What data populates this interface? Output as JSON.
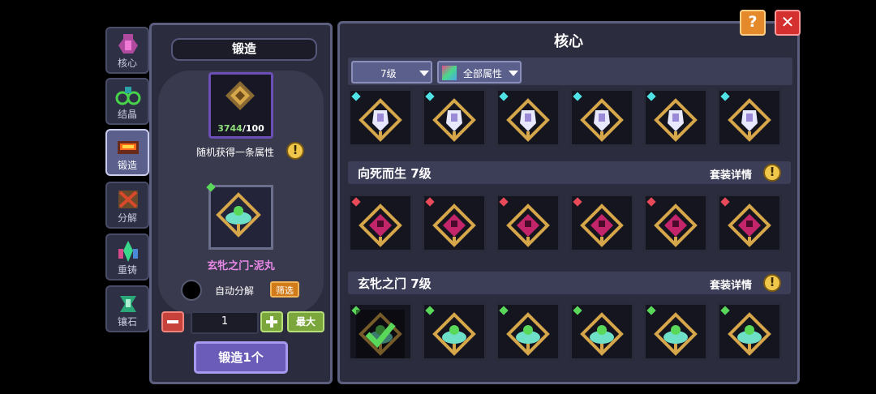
{
  "nav_tabs": [
    {
      "label": "核心",
      "icon": "core-icon"
    },
    {
      "label": "结晶",
      "icon": "crystal-icon"
    },
    {
      "label": "锻造",
      "icon": "forge-icon"
    },
    {
      "label": "分解",
      "icon": "disassemble-icon"
    },
    {
      "label": "重铸",
      "icon": "recast-icon"
    },
    {
      "label": "镶石",
      "icon": "inlay-icon"
    }
  ],
  "forge": {
    "title": "锻造",
    "material_current": "3744",
    "material_required": "/100",
    "random_attr_text": "随机获得一条属性",
    "core_name": "玄牝之门-泥丸",
    "auto_disassemble_label": "自动分解",
    "filter_label": "筛选",
    "quantity": "1",
    "max_label": "最大",
    "forge_button_label": "锻造1个"
  },
  "cores_panel": {
    "title": "核心",
    "level_filter": "7级",
    "attr_filter": "全部属性",
    "sets": [
      {
        "name": "向死而生 7级",
        "detail_label": "套装详情"
      },
      {
        "name": "玄牝之门 7级",
        "detail_label": "套装详情"
      }
    ]
  },
  "colors": {
    "gem_cyan": "#4fe3e8",
    "gem_red": "#e84a5a",
    "gem_green": "#5ad85a",
    "core_gold": "#d6a64a",
    "core_magenta": "#c2256a",
    "core_teal": "#6fe0c8"
  },
  "buttons": {
    "help": "?",
    "close": "✕"
  }
}
